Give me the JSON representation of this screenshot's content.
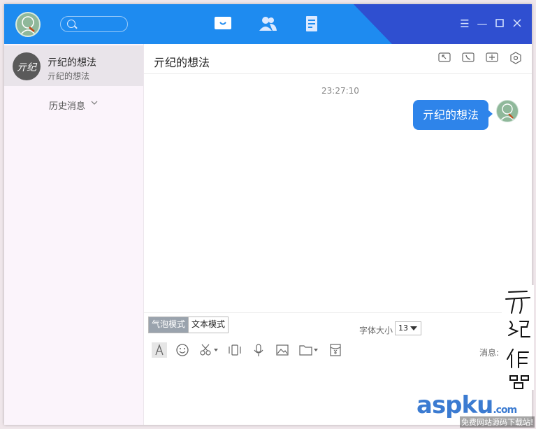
{
  "window": {
    "search": {
      "placeholder": ""
    },
    "nav": [
      "messages-icon",
      "contacts-icon",
      "notes-icon"
    ],
    "controls": [
      "menu-icon",
      "minimize-icon",
      "maximize-icon",
      "close-icon"
    ]
  },
  "sidebar": {
    "contact": {
      "name": "亓纪的想法",
      "preview": "亓纪的想法"
    },
    "history_label": "历史消息"
  },
  "chat": {
    "title": "亓纪的想法",
    "timestamp": "23:27:10",
    "message": "亓纪的想法",
    "toolbar_icons": [
      "share-screen-icon",
      "phone-icon",
      "add-icon",
      "settings-icon"
    ]
  },
  "input": {
    "bubble_mode": "气泡模式",
    "text_mode": "文本模式",
    "font_size_label": "字体大小",
    "font_size": "13",
    "send_hint": "消息:",
    "tools": [
      "font-icon",
      "emoji-icon",
      "scissors-icon",
      "shake-icon",
      "microphone-icon",
      "image-icon",
      "folder-icon",
      "redpacket-icon"
    ]
  },
  "overlay": {
    "signature": "亓纪作品",
    "watermark_brand": "aspku",
    "watermark_domain": ".com",
    "watermark_tagline": "免费网站源码下载站!"
  },
  "colors": {
    "accent": "#1e8bf0",
    "bubble": "#2e84ea",
    "brand_red": "#e4332d"
  }
}
